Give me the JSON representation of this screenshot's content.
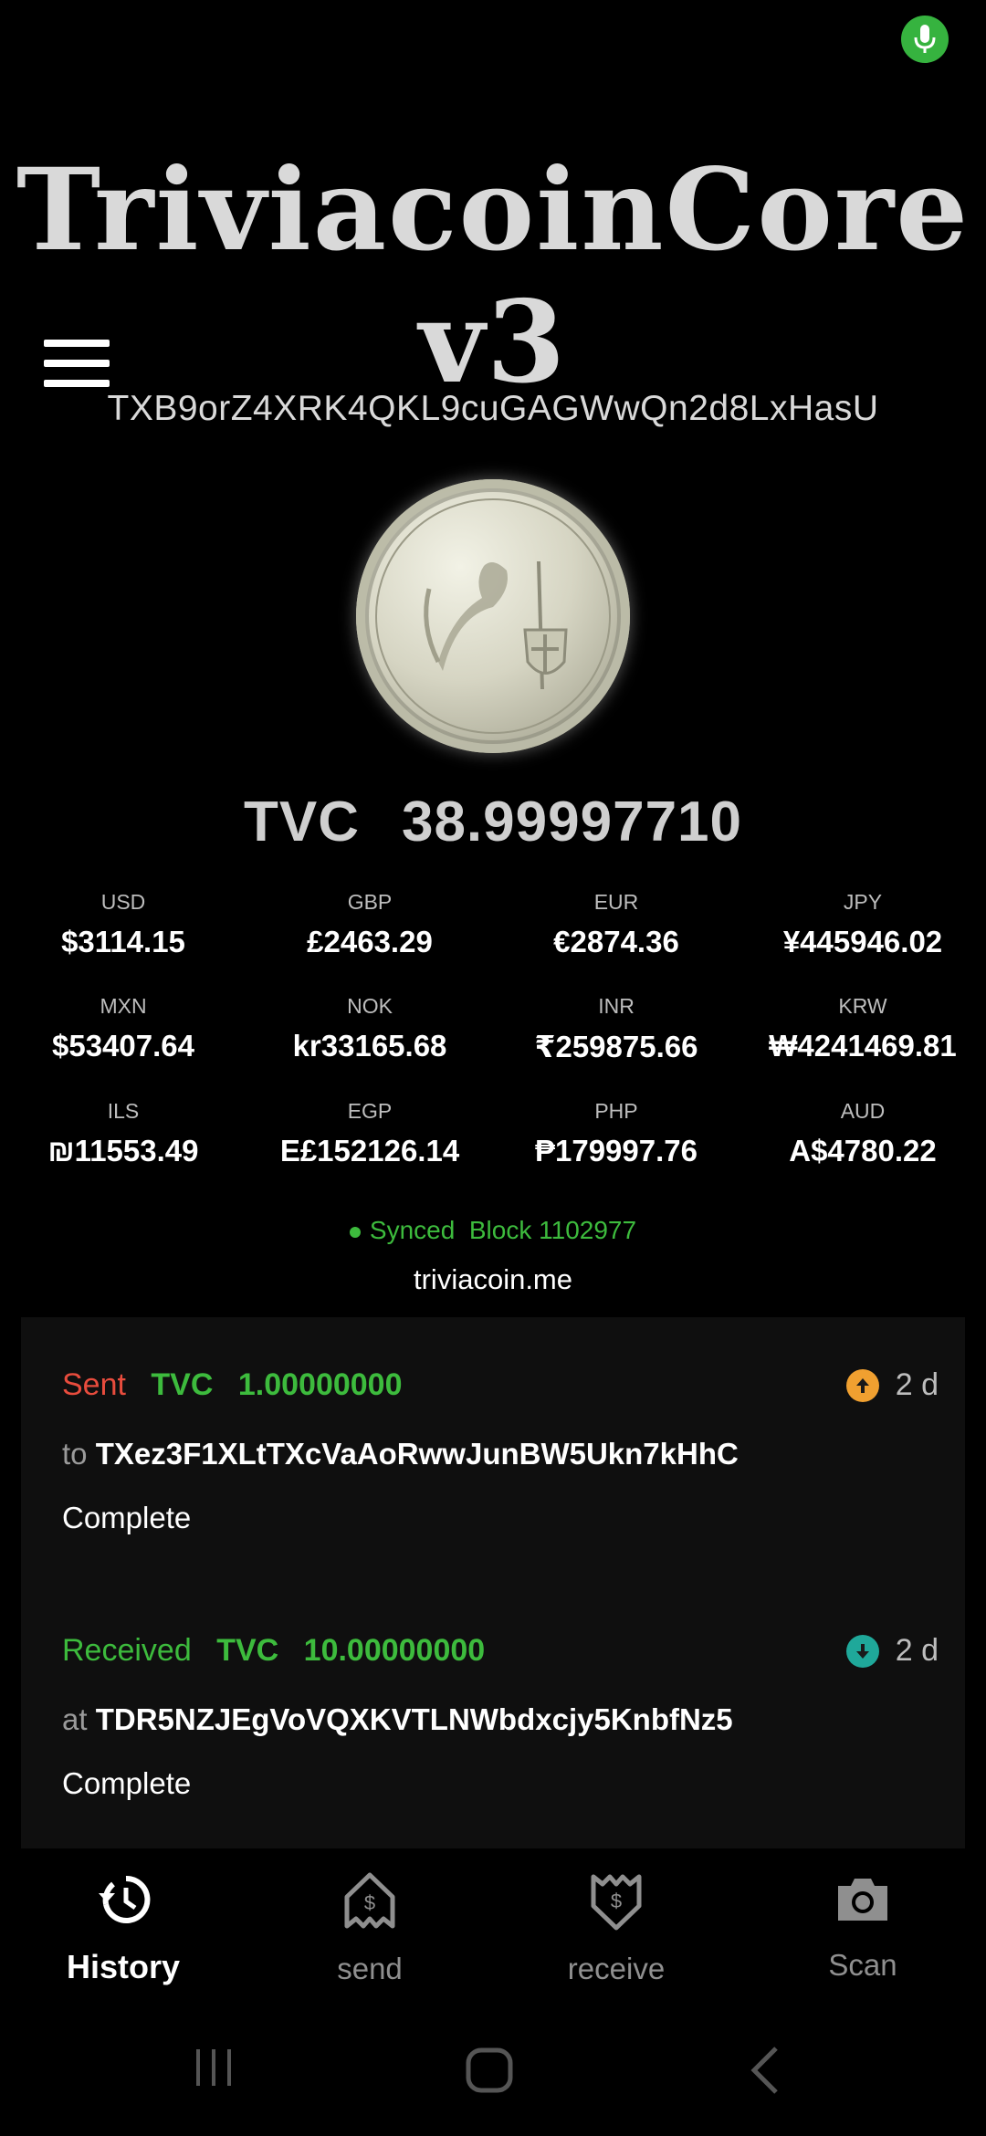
{
  "app_title": "TriviacoinCore v3",
  "wallet_address": "TXB9orZ4XRK4QKL9cuGAGWwQn2d8LxHasU",
  "balance": {
    "symbol": "TVC",
    "amount": "38.99997710"
  },
  "rates": [
    {
      "code": "USD",
      "value": "$3114.15"
    },
    {
      "code": "GBP",
      "value": "£2463.29"
    },
    {
      "code": "EUR",
      "value": "€2874.36"
    },
    {
      "code": "JPY",
      "value": "¥445946.02"
    },
    {
      "code": "MXN",
      "value": "$53407.64"
    },
    {
      "code": "NOK",
      "value": "kr33165.68"
    },
    {
      "code": "INR",
      "value": "₹259875.66"
    },
    {
      "code": "KRW",
      "value": "₩4241469.81"
    },
    {
      "code": "ILS",
      "value": "₪11553.49"
    },
    {
      "code": "EGP",
      "value": "E£152126.14"
    },
    {
      "code": "PHP",
      "value": "₱179997.76"
    },
    {
      "code": "AUD",
      "value": "A$4780.22"
    }
  ],
  "sync_status": "Synced  Block 1102977",
  "website": "triviacoin.me",
  "transactions": [
    {
      "type": "Sent",
      "symbol": "TVC",
      "amount": "1.00000000",
      "age": "2 d",
      "prefix": "to",
      "address": "TXez3F1XLtTXcVaAoRwwJunBW5Ukn7kHhC",
      "status": "Complete",
      "icon": "arrow-up-icon",
      "icon_color": "#f0a030"
    },
    {
      "type": "Received",
      "symbol": "TVC",
      "amount": "10.00000000",
      "age": "2 d",
      "prefix": "at",
      "address": "TDR5NZJEgVoVQXKVTLNWbdxcjy5KnbfNz5",
      "status": "Complete",
      "icon": "arrow-down-icon",
      "icon_color": "#1fa89a"
    }
  ],
  "bottom_nav": [
    {
      "label": "History",
      "icon": "history-icon",
      "active": true
    },
    {
      "label": "send",
      "icon": "send-money-icon",
      "active": false
    },
    {
      "label": "receive",
      "icon": "receive-money-icon",
      "active": false
    },
    {
      "label": "Scan",
      "icon": "camera-icon",
      "active": false
    }
  ],
  "colors": {
    "sent": "#e84c3d",
    "received": "#3dbb3d",
    "mic": "#36b33f"
  }
}
